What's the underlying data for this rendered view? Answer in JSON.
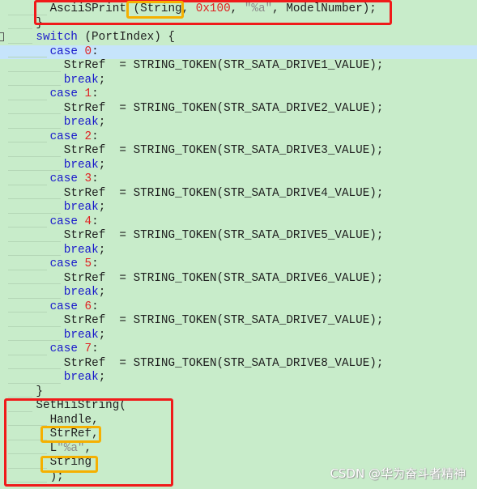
{
  "editor": {
    "highlighted_line": 3,
    "lines": [
      {
        "indent": 6,
        "tokens": [
          [
            "plain",
            "AsciiSPrint"
          ],
          [
            "plain",
            " (String, "
          ],
          [
            "num",
            "0x100"
          ],
          [
            "plain",
            ", "
          ],
          [
            "str",
            "\"%a\""
          ],
          [
            "plain",
            ", ModelNumber);"
          ]
        ]
      },
      {
        "indent": 4,
        "tokens": [
          [
            "plain",
            "}"
          ]
        ]
      },
      {
        "indent": 4,
        "tokens": [
          [
            "kw",
            "switch"
          ],
          [
            "plain",
            " (PortIndex) {"
          ]
        ]
      },
      {
        "indent": 6,
        "tokens": [
          [
            "kw",
            "case"
          ],
          [
            "plain",
            " "
          ],
          [
            "num",
            "0"
          ],
          [
            "plain",
            ":"
          ]
        ]
      },
      {
        "indent": 8,
        "tokens": [
          [
            "plain",
            "StrRef  = STRING_TOKEN(STR_SATA_DRIVE1_VALUE);"
          ]
        ]
      },
      {
        "indent": 8,
        "tokens": [
          [
            "kw",
            "break"
          ],
          [
            "plain",
            ";"
          ]
        ]
      },
      {
        "indent": 6,
        "tokens": [
          [
            "kw",
            "case"
          ],
          [
            "plain",
            " "
          ],
          [
            "num",
            "1"
          ],
          [
            "plain",
            ":"
          ]
        ]
      },
      {
        "indent": 8,
        "tokens": [
          [
            "plain",
            "StrRef  = STRING_TOKEN(STR_SATA_DRIVE2_VALUE);"
          ]
        ]
      },
      {
        "indent": 8,
        "tokens": [
          [
            "kw",
            "break"
          ],
          [
            "plain",
            ";"
          ]
        ]
      },
      {
        "indent": 6,
        "tokens": [
          [
            "kw",
            "case"
          ],
          [
            "plain",
            " "
          ],
          [
            "num",
            "2"
          ],
          [
            "plain",
            ":"
          ]
        ]
      },
      {
        "indent": 8,
        "tokens": [
          [
            "plain",
            "StrRef  = STRING_TOKEN(STR_SATA_DRIVE3_VALUE);"
          ]
        ]
      },
      {
        "indent": 8,
        "tokens": [
          [
            "kw",
            "break"
          ],
          [
            "plain",
            ";"
          ]
        ]
      },
      {
        "indent": 6,
        "tokens": [
          [
            "kw",
            "case"
          ],
          [
            "plain",
            " "
          ],
          [
            "num",
            "3"
          ],
          [
            "plain",
            ":"
          ]
        ]
      },
      {
        "indent": 8,
        "tokens": [
          [
            "plain",
            "StrRef  = STRING_TOKEN(STR_SATA_DRIVE4_VALUE);"
          ]
        ]
      },
      {
        "indent": 8,
        "tokens": [
          [
            "kw",
            "break"
          ],
          [
            "plain",
            ";"
          ]
        ]
      },
      {
        "indent": 6,
        "tokens": [
          [
            "kw",
            "case"
          ],
          [
            "plain",
            " "
          ],
          [
            "num",
            "4"
          ],
          [
            "plain",
            ":"
          ]
        ]
      },
      {
        "indent": 8,
        "tokens": [
          [
            "plain",
            "StrRef  = STRING_TOKEN(STR_SATA_DRIVE5_VALUE);"
          ]
        ]
      },
      {
        "indent": 8,
        "tokens": [
          [
            "kw",
            "break"
          ],
          [
            "plain",
            ";"
          ]
        ]
      },
      {
        "indent": 6,
        "tokens": [
          [
            "kw",
            "case"
          ],
          [
            "plain",
            " "
          ],
          [
            "num",
            "5"
          ],
          [
            "plain",
            ":"
          ]
        ]
      },
      {
        "indent": 8,
        "tokens": [
          [
            "plain",
            "StrRef  = STRING_TOKEN(STR_SATA_DRIVE6_VALUE);"
          ]
        ]
      },
      {
        "indent": 8,
        "tokens": [
          [
            "kw",
            "break"
          ],
          [
            "plain",
            ";"
          ]
        ]
      },
      {
        "indent": 6,
        "tokens": [
          [
            "kw",
            "case"
          ],
          [
            "plain",
            " "
          ],
          [
            "num",
            "6"
          ],
          [
            "plain",
            ":"
          ]
        ]
      },
      {
        "indent": 8,
        "tokens": [
          [
            "plain",
            "StrRef  = STRING_TOKEN(STR_SATA_DRIVE7_VALUE);"
          ]
        ]
      },
      {
        "indent": 8,
        "tokens": [
          [
            "kw",
            "break"
          ],
          [
            "plain",
            ";"
          ]
        ]
      },
      {
        "indent": 6,
        "tokens": [
          [
            "kw",
            "case"
          ],
          [
            "plain",
            " "
          ],
          [
            "num",
            "7"
          ],
          [
            "plain",
            ":"
          ]
        ]
      },
      {
        "indent": 8,
        "tokens": [
          [
            "plain",
            "StrRef  = STRING_TOKEN(STR_SATA_DRIVE8_VALUE);"
          ]
        ]
      },
      {
        "indent": 8,
        "tokens": [
          [
            "kw",
            "break"
          ],
          [
            "plain",
            ";"
          ]
        ]
      },
      {
        "indent": 4,
        "tokens": [
          [
            "plain",
            "}"
          ]
        ]
      },
      {
        "indent": 4,
        "tokens": [
          [
            "plain",
            "SetHiiString("
          ]
        ]
      },
      {
        "indent": 6,
        "tokens": [
          [
            "plain",
            "Handle,"
          ]
        ]
      },
      {
        "indent": 6,
        "tokens": [
          [
            "plain",
            "StrRef,"
          ]
        ]
      },
      {
        "indent": 6,
        "tokens": [
          [
            "plain",
            "L"
          ],
          [
            "str",
            "\"%a\""
          ],
          [
            "plain",
            ","
          ]
        ]
      },
      {
        "indent": 6,
        "tokens": [
          [
            "plain",
            "String"
          ]
        ]
      },
      {
        "indent": 6,
        "tokens": [
          [
            "plain",
            ");"
          ]
        ]
      }
    ]
  },
  "colors": {
    "background": "#c8ecca",
    "highlight": "#c6e4fb",
    "red_box": "#f01a1a",
    "orange_box": "#f5b000",
    "keyword": "#1a1acc",
    "number": "#e02020",
    "string": "#8a8a8a"
  },
  "watermark": "CSDN @华为奋斗者精神"
}
